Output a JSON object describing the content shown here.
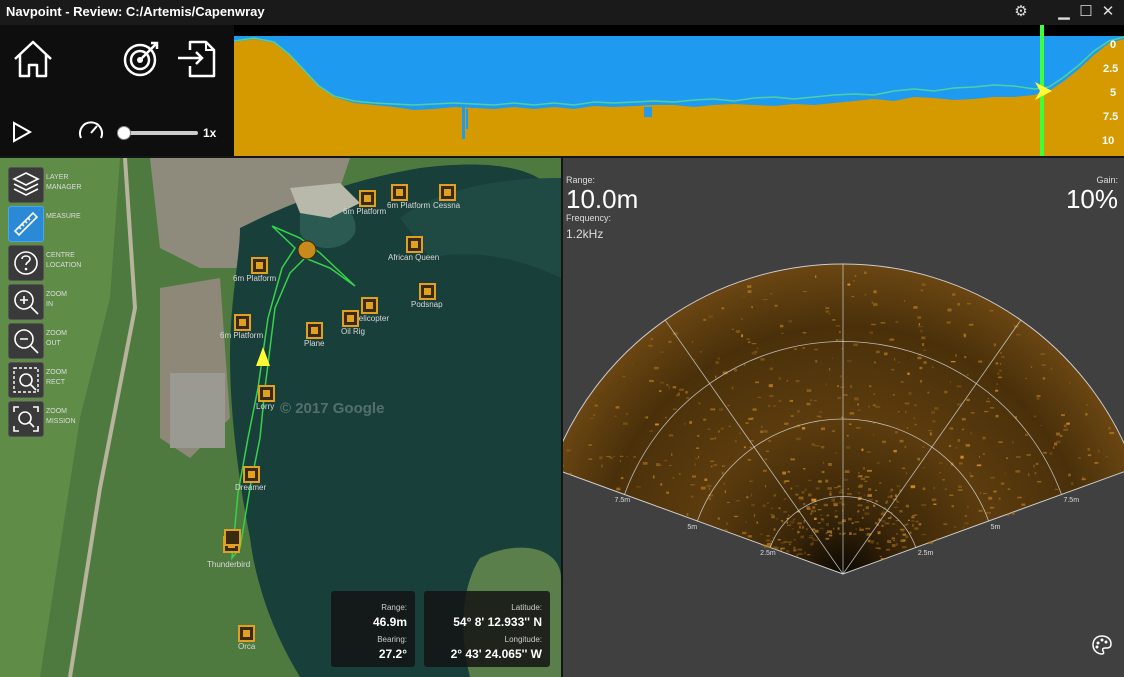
{
  "window": {
    "title": "Navpoint - Review: C:/Artemis/Capenwray",
    "settings_icon": "gear-icon",
    "minimize_icon": "minimize-icon",
    "maximize_icon": "maximize-icon",
    "close_icon": "close-icon"
  },
  "playback": {
    "speed_label": "1x",
    "speed_fraction": 0.0
  },
  "profile": {
    "depth_ticks": [
      "0",
      "2.5",
      "5",
      "7.5",
      "10"
    ],
    "colors": {
      "water": "#1e9bf0",
      "ground": "#d49a00",
      "cursor": "#3dff3d",
      "track": "#4fd0a0"
    }
  },
  "tools": [
    {
      "name": "layer-manager",
      "icon": "layers-icon",
      "line1": "LAYER",
      "line2": "MANAGER",
      "active": false
    },
    {
      "name": "measure",
      "icon": "ruler-icon",
      "line1": "MEASURE",
      "line2": "",
      "active": true
    },
    {
      "name": "centre-location",
      "icon": "question-icon",
      "line1": "CENTRE",
      "line2": "LOCATION",
      "active": false
    },
    {
      "name": "zoom-in",
      "icon": "zoom-in-icon",
      "line1": "ZOOM",
      "line2": "IN",
      "active": false
    },
    {
      "name": "zoom-out",
      "icon": "zoom-out-icon",
      "line1": "ZOOM",
      "line2": "OUT",
      "active": false
    },
    {
      "name": "zoom-rect",
      "icon": "zoom-rect-icon",
      "line1": "ZOOM",
      "line2": "RECT",
      "active": false
    },
    {
      "name": "zoom-mission",
      "icon": "zoom-mission-icon",
      "line1": "ZOOM",
      "line2": "MISSION",
      "active": false
    }
  ],
  "map": {
    "watermark": "© 2017 Google",
    "markers": [
      "6m Platform",
      "Cessna",
      "African Queen",
      "Podsnap",
      "Helicopter",
      "Oil Rig",
      "Plane",
      "Lorry",
      "Dreamer",
      "Thunderbird",
      "Orca"
    ],
    "markers_b": [
      "6m Platform",
      "6m Platform",
      "6m Platform"
    ],
    "range_label": "Range:",
    "range_value": "46.9m",
    "bearing_label": "Bearing:",
    "bearing_value": "27.2°",
    "latitude_label": "Latitude:",
    "latitude_value": "54° 8' 12.933'' N",
    "longitude_label": "Longitude:",
    "longitude_value": "2° 43' 24.065'' W"
  },
  "sonar": {
    "range_label": "Range:",
    "range_value": "10.0m",
    "frequency_label": "Frequency:",
    "frequency_value": "1.2kHz",
    "gain_label": "Gain:",
    "gain_value": "10%",
    "ring_labels": [
      "2.5m",
      "5m",
      "7.5m"
    ],
    "palette_icon": "palette-icon"
  }
}
